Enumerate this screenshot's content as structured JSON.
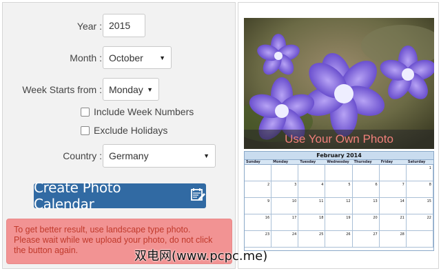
{
  "form": {
    "year_label": "Year :",
    "year_value": "2015",
    "month_label": "Month :",
    "month_value": "October",
    "week_label": "Week Starts from :",
    "week_value": "Monday",
    "include_week_numbers": "Include Week Numbers",
    "exclude_holidays": "Exclude Holidays",
    "country_label": "Country :",
    "country_value": "Germany",
    "create_button": "Create Photo Calendar",
    "alert_line1": "To get better result, use landscape type photo.",
    "alert_line2": "Please wait while we upload your photo, do not click the button again."
  },
  "preview": {
    "photo_caption": "Use Your Own Photo",
    "calendar_title": "February 2014",
    "weekdays": [
      "Sunday",
      "Monday",
      "Tuesday",
      "Wednesday",
      "Thursday",
      "Friday",
      "Saturday"
    ],
    "cells": [
      "",
      "",
      "",
      "",
      "",
      "",
      "1",
      "2",
      "3",
      "4",
      "5",
      "6",
      "7",
      "8",
      "9",
      "10",
      "11",
      "12",
      "13",
      "14",
      "15",
      "16",
      "17",
      "18",
      "19",
      "20",
      "21",
      "22",
      "23",
      "24",
      "25",
      "26",
      "27",
      "28",
      ""
    ]
  },
  "watermark": "双电网(www.pcpc.me)",
  "colors": {
    "button_bg": "#316aa3",
    "alert_bg": "#f29393",
    "alert_text": "#c0392b",
    "calendar_header": "#c9dcef"
  }
}
